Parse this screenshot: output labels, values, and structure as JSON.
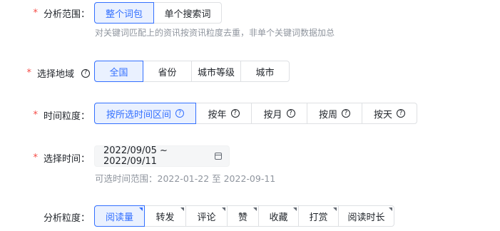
{
  "scope": {
    "label": "分析范围：",
    "required": true,
    "options": [
      "整个词包",
      "单个搜索词"
    ],
    "selected": "整个词包",
    "hint": "对关键词匹配上的资讯按资讯粒度去重，非单个关键词数据加总"
  },
  "region": {
    "label": "选择地域",
    "required": true,
    "help_icon": "question-circle-icon",
    "options": [
      "全国",
      "省份",
      "城市等级",
      "城市"
    ],
    "selected": "全国"
  },
  "time_granularity": {
    "label": "时间粒度：",
    "required": true,
    "options": [
      "按所选时间区间",
      "按年",
      "按月",
      "按周",
      "按天"
    ],
    "selected": "按所选时间区间"
  },
  "time_select": {
    "label": "选择时间：",
    "required": true,
    "value": "2022/09/05 ~ 2022/09/11",
    "icon": "calendar-icon",
    "hint": "可选时间范围：2022-01-22 至 2022-09-11"
  },
  "analysis": {
    "label": "分析粒度：",
    "required": false,
    "options": [
      "阅读量",
      "转发",
      "评论",
      "赞",
      "收藏",
      "打赏",
      "阅读时长"
    ],
    "selected": "阅读量"
  },
  "colors": {
    "accent": "#3370ff",
    "required": "#f54a45",
    "hint": "#8f959e",
    "border": "#dee0e3"
  }
}
